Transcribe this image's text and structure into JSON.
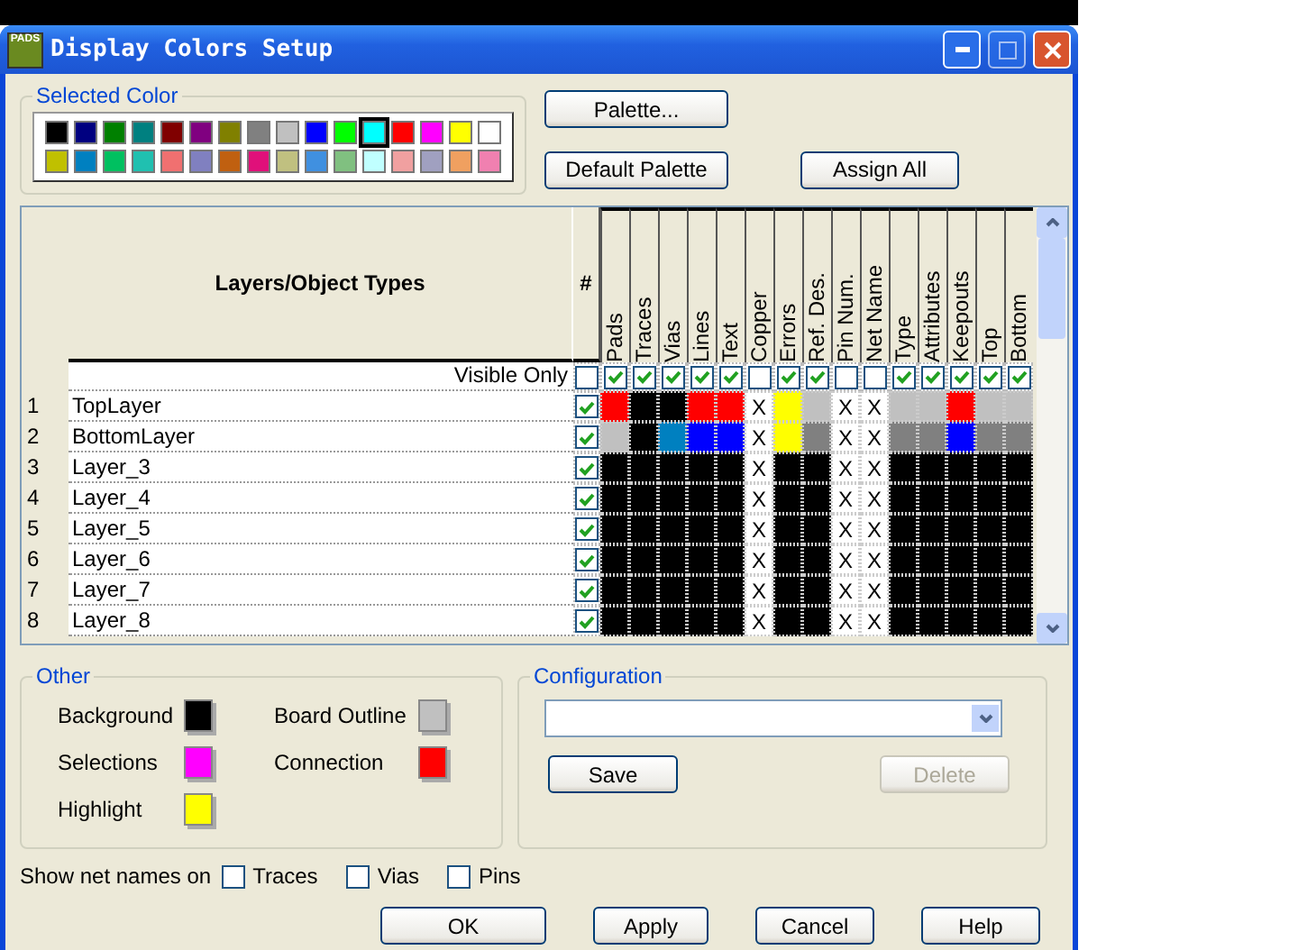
{
  "window": {
    "title": "Display Colors Setup",
    "app_badge": "PADS"
  },
  "selected_color": {
    "label": "Selected Color",
    "palette": [
      {
        "color": "#000000",
        "selected": false
      },
      {
        "color": "#000080",
        "selected": false
      },
      {
        "color": "#008000",
        "selected": false
      },
      {
        "color": "#008080",
        "selected": false
      },
      {
        "color": "#800000",
        "selected": false
      },
      {
        "color": "#800080",
        "selected": false
      },
      {
        "color": "#808000",
        "selected": false
      },
      {
        "color": "#808080",
        "selected": false
      },
      {
        "color": "#c0c0c0",
        "selected": false
      },
      {
        "color": "#0000ff",
        "selected": false
      },
      {
        "color": "#00ff00",
        "selected": false
      },
      {
        "color": "#00ffff",
        "selected": true
      },
      {
        "color": "#ff0000",
        "selected": false
      },
      {
        "color": "#ff00ff",
        "selected": false
      },
      {
        "color": "#ffff00",
        "selected": false
      },
      {
        "color": "#ffffff",
        "selected": false
      },
      {
        "color": "#c0c000",
        "selected": false
      },
      {
        "color": "#0080c0",
        "selected": false
      },
      {
        "color": "#00c060",
        "selected": false
      },
      {
        "color": "#20c0b0",
        "selected": false
      },
      {
        "color": "#f07070",
        "selected": false
      },
      {
        "color": "#8080c0",
        "selected": false
      },
      {
        "color": "#c06010",
        "selected": false
      },
      {
        "color": "#e0107a",
        "selected": false
      },
      {
        "color": "#c0c080",
        "selected": false
      },
      {
        "color": "#4090e0",
        "selected": false
      },
      {
        "color": "#80c080",
        "selected": false
      },
      {
        "color": "#c0ffff",
        "selected": false
      },
      {
        "color": "#f0a0a0",
        "selected": false
      },
      {
        "color": "#a0a0c0",
        "selected": false
      },
      {
        "color": "#f0a060",
        "selected": false
      },
      {
        "color": "#f080b0",
        "selected": false
      }
    ]
  },
  "palette_buttons": [
    "Palette...",
    "Default Palette",
    "Assign All"
  ],
  "table": {
    "name_header": "Layers/Object Types",
    "hash_header": "#",
    "visible_only_label": "Visible Only",
    "visible_only_all": false,
    "columns": [
      {
        "label": "Pads",
        "visible": true
      },
      {
        "label": "Traces",
        "visible": true
      },
      {
        "label": "Vias",
        "visible": true
      },
      {
        "label": "Lines",
        "visible": true
      },
      {
        "label": "Text",
        "visible": true
      },
      {
        "label": "Copper",
        "visible": false
      },
      {
        "label": "Errors",
        "visible": true
      },
      {
        "label": "Ref. Des.",
        "visible": true
      },
      {
        "label": "Pin Num.",
        "visible": false
      },
      {
        "label": "Net Name",
        "visible": false
      },
      {
        "label": "Type",
        "visible": true
      },
      {
        "label": "Attributes",
        "visible": true
      },
      {
        "label": "Keepouts",
        "visible": true
      },
      {
        "label": "Top",
        "visible": true
      },
      {
        "label": "Bottom",
        "visible": true
      }
    ],
    "rows": [
      {
        "num": "1",
        "name": "TopLayer",
        "checked": true,
        "cells": [
          {
            "kind": "swatch",
            "color": "#ff0000"
          },
          {
            "kind": "swatch",
            "color": "#000000"
          },
          {
            "kind": "swatch",
            "color": "#000000"
          },
          {
            "kind": "swatch",
            "color": "#ff0000"
          },
          {
            "kind": "swatch",
            "color": "#ff0000"
          },
          {
            "kind": "mark",
            "text": "X"
          },
          {
            "kind": "swatch",
            "color": "#ffff00"
          },
          {
            "kind": "swatch",
            "color": "#c0c0c0"
          },
          {
            "kind": "mark",
            "text": "X"
          },
          {
            "kind": "mark",
            "text": "X"
          },
          {
            "kind": "swatch",
            "color": "#c0c0c0"
          },
          {
            "kind": "swatch",
            "color": "#c0c0c0"
          },
          {
            "kind": "swatch",
            "color": "#ff0000"
          },
          {
            "kind": "swatch",
            "color": "#c0c0c0"
          },
          {
            "kind": "swatch",
            "color": "#c0c0c0"
          }
        ]
      },
      {
        "num": "2",
        "name": "BottomLayer",
        "checked": true,
        "cells": [
          {
            "kind": "swatch",
            "color": "#c0c0c0"
          },
          {
            "kind": "swatch",
            "color": "#000000"
          },
          {
            "kind": "swatch",
            "color": "#0080c0"
          },
          {
            "kind": "swatch",
            "color": "#0000ff"
          },
          {
            "kind": "swatch",
            "color": "#0000ff"
          },
          {
            "kind": "mark",
            "text": "X"
          },
          {
            "kind": "swatch",
            "color": "#ffff00"
          },
          {
            "kind": "swatch",
            "color": "#808080"
          },
          {
            "kind": "mark",
            "text": "X"
          },
          {
            "kind": "mark",
            "text": "X"
          },
          {
            "kind": "swatch",
            "color": "#808080"
          },
          {
            "kind": "swatch",
            "color": "#808080"
          },
          {
            "kind": "swatch",
            "color": "#0000ff"
          },
          {
            "kind": "swatch",
            "color": "#808080"
          },
          {
            "kind": "swatch",
            "color": "#808080"
          }
        ]
      },
      {
        "num": "3",
        "name": "Layer_3",
        "checked": true,
        "cells": [
          {
            "kind": "swatch",
            "color": "#000000"
          },
          {
            "kind": "swatch",
            "color": "#000000"
          },
          {
            "kind": "swatch",
            "color": "#000000"
          },
          {
            "kind": "swatch",
            "color": "#000000"
          },
          {
            "kind": "swatch",
            "color": "#000000"
          },
          {
            "kind": "mark",
            "text": "X"
          },
          {
            "kind": "swatch",
            "color": "#000000"
          },
          {
            "kind": "swatch",
            "color": "#000000"
          },
          {
            "kind": "mark",
            "text": "X"
          },
          {
            "kind": "mark",
            "text": "X"
          },
          {
            "kind": "swatch",
            "color": "#000000"
          },
          {
            "kind": "swatch",
            "color": "#000000"
          },
          {
            "kind": "swatch",
            "color": "#000000"
          },
          {
            "kind": "swatch",
            "color": "#000000"
          },
          {
            "kind": "swatch",
            "color": "#000000"
          }
        ]
      },
      {
        "num": "4",
        "name": "Layer_4",
        "checked": true,
        "cells": [
          {
            "kind": "swatch",
            "color": "#000000"
          },
          {
            "kind": "swatch",
            "color": "#000000"
          },
          {
            "kind": "swatch",
            "color": "#000000"
          },
          {
            "kind": "swatch",
            "color": "#000000"
          },
          {
            "kind": "swatch",
            "color": "#000000"
          },
          {
            "kind": "mark",
            "text": "X"
          },
          {
            "kind": "swatch",
            "color": "#000000"
          },
          {
            "kind": "swatch",
            "color": "#000000"
          },
          {
            "kind": "mark",
            "text": "X"
          },
          {
            "kind": "mark",
            "text": "X"
          },
          {
            "kind": "swatch",
            "color": "#000000"
          },
          {
            "kind": "swatch",
            "color": "#000000"
          },
          {
            "kind": "swatch",
            "color": "#000000"
          },
          {
            "kind": "swatch",
            "color": "#000000"
          },
          {
            "kind": "swatch",
            "color": "#000000"
          }
        ]
      },
      {
        "num": "5",
        "name": "Layer_5",
        "checked": true,
        "cells": [
          {
            "kind": "swatch",
            "color": "#000000"
          },
          {
            "kind": "swatch",
            "color": "#000000"
          },
          {
            "kind": "swatch",
            "color": "#000000"
          },
          {
            "kind": "swatch",
            "color": "#000000"
          },
          {
            "kind": "swatch",
            "color": "#000000"
          },
          {
            "kind": "mark",
            "text": "X"
          },
          {
            "kind": "swatch",
            "color": "#000000"
          },
          {
            "kind": "swatch",
            "color": "#000000"
          },
          {
            "kind": "mark",
            "text": "X"
          },
          {
            "kind": "mark",
            "text": "X"
          },
          {
            "kind": "swatch",
            "color": "#000000"
          },
          {
            "kind": "swatch",
            "color": "#000000"
          },
          {
            "kind": "swatch",
            "color": "#000000"
          },
          {
            "kind": "swatch",
            "color": "#000000"
          },
          {
            "kind": "swatch",
            "color": "#000000"
          }
        ]
      },
      {
        "num": "6",
        "name": "Layer_6",
        "checked": true,
        "cells": [
          {
            "kind": "swatch",
            "color": "#000000"
          },
          {
            "kind": "swatch",
            "color": "#000000"
          },
          {
            "kind": "swatch",
            "color": "#000000"
          },
          {
            "kind": "swatch",
            "color": "#000000"
          },
          {
            "kind": "swatch",
            "color": "#000000"
          },
          {
            "kind": "mark",
            "text": "X"
          },
          {
            "kind": "swatch",
            "color": "#000000"
          },
          {
            "kind": "swatch",
            "color": "#000000"
          },
          {
            "kind": "mark",
            "text": "X"
          },
          {
            "kind": "mark",
            "text": "X"
          },
          {
            "kind": "swatch",
            "color": "#000000"
          },
          {
            "kind": "swatch",
            "color": "#000000"
          },
          {
            "kind": "swatch",
            "color": "#000000"
          },
          {
            "kind": "swatch",
            "color": "#000000"
          },
          {
            "kind": "swatch",
            "color": "#000000"
          }
        ]
      },
      {
        "num": "7",
        "name": "Layer_7",
        "checked": true,
        "cells": [
          {
            "kind": "swatch",
            "color": "#000000"
          },
          {
            "kind": "swatch",
            "color": "#000000"
          },
          {
            "kind": "swatch",
            "color": "#000000"
          },
          {
            "kind": "swatch",
            "color": "#000000"
          },
          {
            "kind": "swatch",
            "color": "#000000"
          },
          {
            "kind": "mark",
            "text": "X"
          },
          {
            "kind": "swatch",
            "color": "#000000"
          },
          {
            "kind": "swatch",
            "color": "#000000"
          },
          {
            "kind": "mark",
            "text": "X"
          },
          {
            "kind": "mark",
            "text": "X"
          },
          {
            "kind": "swatch",
            "color": "#000000"
          },
          {
            "kind": "swatch",
            "color": "#000000"
          },
          {
            "kind": "swatch",
            "color": "#000000"
          },
          {
            "kind": "swatch",
            "color": "#000000"
          },
          {
            "kind": "swatch",
            "color": "#000000"
          }
        ]
      },
      {
        "num": "8",
        "name": "Layer_8",
        "checked": true,
        "cells": [
          {
            "kind": "swatch",
            "color": "#000000"
          },
          {
            "kind": "swatch",
            "color": "#000000"
          },
          {
            "kind": "swatch",
            "color": "#000000"
          },
          {
            "kind": "swatch",
            "color": "#000000"
          },
          {
            "kind": "swatch",
            "color": "#000000"
          },
          {
            "kind": "mark",
            "text": "X"
          },
          {
            "kind": "swatch",
            "color": "#000000"
          },
          {
            "kind": "swatch",
            "color": "#000000"
          },
          {
            "kind": "mark",
            "text": "X"
          },
          {
            "kind": "mark",
            "text": "X"
          },
          {
            "kind": "swatch",
            "color": "#000000"
          },
          {
            "kind": "swatch",
            "color": "#000000"
          },
          {
            "kind": "swatch",
            "color": "#000000"
          },
          {
            "kind": "swatch",
            "color": "#000000"
          },
          {
            "kind": "swatch",
            "color": "#000000"
          }
        ]
      }
    ]
  },
  "other": {
    "label": "Other",
    "items": [
      {
        "label": "Background",
        "color": "#000000"
      },
      {
        "label": "Board Outline",
        "color": "#c0c0c0"
      },
      {
        "label": "Selections",
        "color": "#ff00ff"
      },
      {
        "label": "Connection",
        "color": "#ff0000"
      },
      {
        "label": "Highlight",
        "color": "#ffff00"
      }
    ]
  },
  "configuration": {
    "label": "Configuration",
    "save": {
      "label": "Save",
      "disabled": false
    },
    "delete": {
      "label": "Delete",
      "disabled": true
    }
  },
  "net_names": {
    "label": "Show net names on",
    "options": [
      {
        "label": "Traces",
        "checked": false
      },
      {
        "label": "Vias",
        "checked": false
      },
      {
        "label": "Pins",
        "checked": false
      }
    ]
  },
  "buttons": [
    "OK",
    "Apply",
    "Cancel",
    "Help"
  ]
}
